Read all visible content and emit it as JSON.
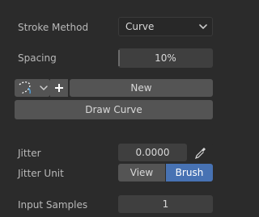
{
  "stroke_method": {
    "label": "Stroke Method",
    "value": "Curve"
  },
  "spacing": {
    "label": "Spacing",
    "value": "10%"
  },
  "curve_row": {
    "new_label": "New"
  },
  "draw_curve": {
    "label": "Draw Curve"
  },
  "jitter": {
    "label": "Jitter",
    "value": "0.0000"
  },
  "jitter_unit": {
    "label": "Jitter Unit",
    "options": [
      "View",
      "Brush"
    ],
    "selected": "Brush"
  },
  "input_samples": {
    "label": "Input Samples",
    "value": "1"
  },
  "colors": {
    "accent": "#4772b3",
    "field": "#545454",
    "background": "#2b2b2b"
  },
  "icons": [
    "chevron-down-icon",
    "curve-icon",
    "plus-icon",
    "eyedropper-icon"
  ]
}
